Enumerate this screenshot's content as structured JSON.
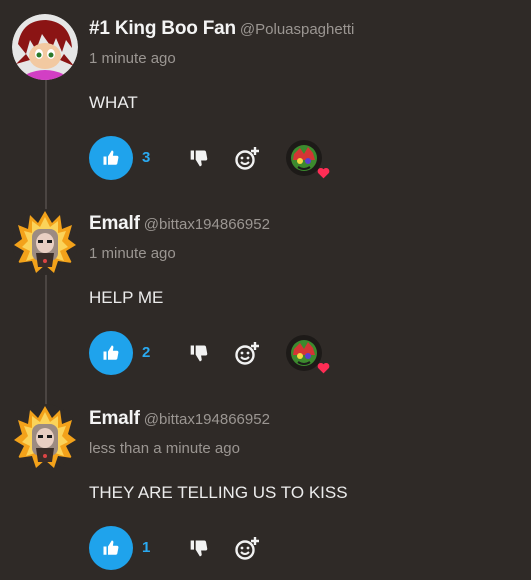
{
  "comments": [
    {
      "name": "#1 King Boo Fan",
      "handle": "@Poluaspaghetti",
      "time": "1 minute ago",
      "text": "WHAT",
      "likes": "3",
      "avatar_icon": "hedgehog-avatar",
      "has_reaction": true
    },
    {
      "name": "Emalf",
      "handle": "@bittax194866952",
      "time": "1 minute ago",
      "text": "HELP ME",
      "likes": "2",
      "avatar_icon": "flame-avatar",
      "has_reaction": true
    },
    {
      "name": "Emalf",
      "handle": "@bittax194866952",
      "time": "less than a minute ago",
      "text": "THEY ARE TELLING US TO KISS",
      "likes": "1",
      "avatar_icon": "flame-avatar",
      "has_reaction": false
    }
  ],
  "colors": {
    "accent": "#1fa3ec",
    "heart": "#ff2d55",
    "background": "#2f2a27"
  }
}
